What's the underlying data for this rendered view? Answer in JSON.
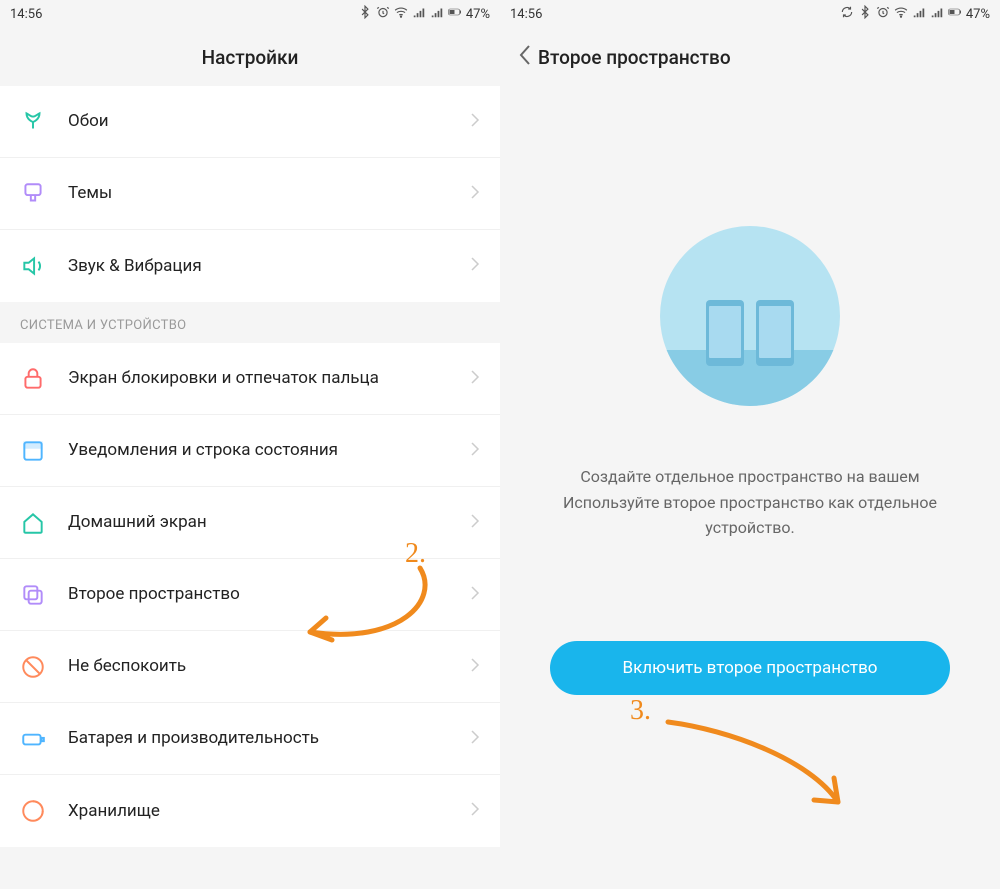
{
  "left": {
    "status": {
      "time": "14:56",
      "battery": "47%"
    },
    "header": {
      "title": "Настройки"
    },
    "items": [
      {
        "icon": "tulip",
        "color": "#26c6a7",
        "label": "Обои"
      },
      {
        "icon": "brush",
        "color": "#b18cf9",
        "label": "Темы"
      },
      {
        "icon": "sound",
        "color": "#26c6a7",
        "label": "Звук & Вибрация"
      }
    ],
    "section": "СИСТЕМА И УСТРОЙСТВО",
    "items2": [
      {
        "icon": "lock",
        "color": "#ff6b6b",
        "label": "Экран блокировки и отпечаток пальца"
      },
      {
        "icon": "notif",
        "color": "#4fb5ff",
        "label": "Уведомления и строка состояния"
      },
      {
        "icon": "home",
        "color": "#26c6a7",
        "label": "Домашний экран"
      },
      {
        "icon": "copy",
        "color": "#b18cf9",
        "label": "Второе пространство"
      },
      {
        "icon": "dnd",
        "color": "#ff8a5c",
        "label": "Не беспокоить"
      },
      {
        "icon": "battery",
        "color": "#4fb5ff",
        "label": "Батарея и производительность"
      },
      {
        "icon": "storage",
        "color": "#ff8a5c",
        "label": "Хранилище"
      }
    ]
  },
  "right": {
    "status": {
      "time": "14:56",
      "battery": "47%"
    },
    "header": {
      "title": "Второе пространство"
    },
    "desc1": "Создайте отдельное пространство на вашем",
    "desc2": "Используйте второе пространство как отдельное устройство.",
    "cta": "Включить второе пространство"
  },
  "annotations": {
    "step2": "2.",
    "step3": "3."
  }
}
